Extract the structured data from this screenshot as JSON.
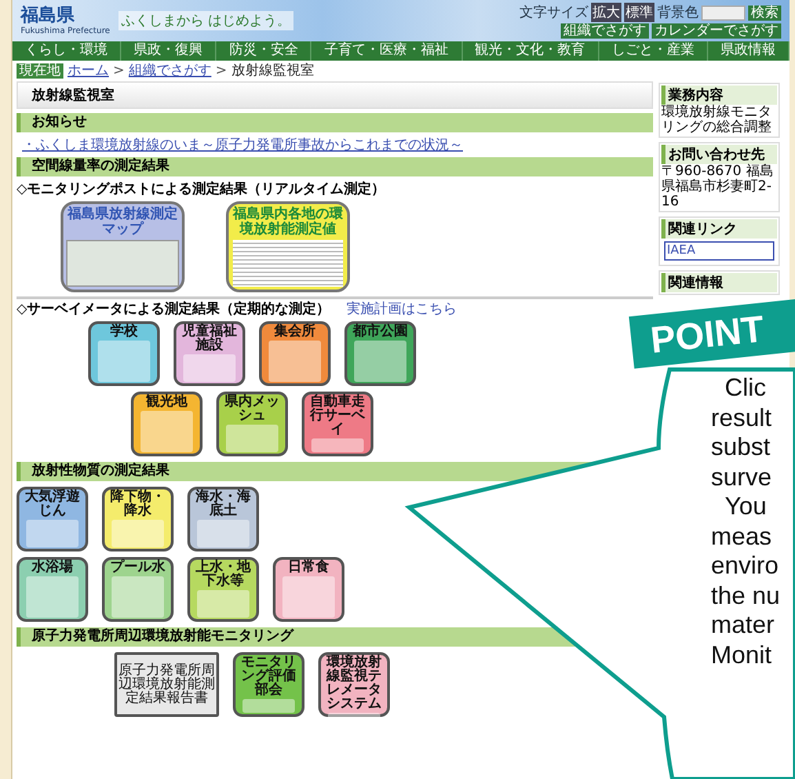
{
  "header": {
    "logo": "福島県",
    "logo_sub": "Fukushima Prefecture",
    "tagline": "ふくしまから はじめよう。",
    "controls": [
      "文字サイズ",
      "拡大",
      "標準",
      "背景色"
    ],
    "search_button": "検索",
    "buttons": [
      "組織でさがす",
      "カレンダーでさがす"
    ]
  },
  "nav": [
    "くらし・環境",
    "県政・復興",
    "防災・安全",
    "子育て・医療・福祉",
    "観光・文化・教育",
    "しごと・産業",
    "県政情報"
  ],
  "breadcrumb": {
    "label": "現在地",
    "separator": ">",
    "items": [
      "ホーム",
      "組織でさがす",
      "放射線監視室"
    ]
  },
  "page_title": "放射線監視室",
  "sections": [
    {
      "title": "お知らせ",
      "links": [
        "・ふくしま環境放射線のいま～原子力発電所事故からこれまでの状況～"
      ]
    },
    {
      "title": "空間線量率の測定結果",
      "groups": [
        {
          "caption": "◇モニタリングポストによる測定結果（リアルタイム測定）",
          "cards": [
            {
              "kind": "map",
              "label": "福島県放射線測定マップ",
              "color": "#b7bfe6"
            },
            {
              "kind": "table",
              "label": "福島県内各地の環境放射能測定値",
              "color": "#f2ec4a"
            }
          ]
        },
        {
          "caption": "◇サーベイメータによる測定結果（定期的な測定）",
          "link": "実施計画はこちら",
          "rows": [
            [
              {
                "label": "学校",
                "color": "#6ec7dc"
              },
              {
                "label": "児童福祉施設",
                "color": "#e3b6dc"
              },
              {
                "label": "集会所",
                "color": "#f08a3c"
              },
              {
                "label": "都市公園",
                "color": "#3fa65a"
              }
            ],
            [
              {
                "label": "観光地",
                "color": "#f4b531"
              },
              {
                "label": "県内メッシュ",
                "color": "#a8d04a"
              },
              {
                "label": "自動車走行サーベイ",
                "color": "#ee7a86"
              }
            ]
          ]
        }
      ]
    },
    {
      "title": "放射性物質の測定結果",
      "groups": [
        {
          "rows": [
            [
              {
                "label": "大気浮遊じん",
                "color": "#8fb7e2"
              },
              {
                "label": "降下物・降水",
                "color": "#f4ec6c"
              },
              {
                "label": "海水・海底土",
                "color": "#b9c6d9"
              }
            ],
            [
              {
                "label": "水浴場",
                "color": "#8ccfb0"
              },
              {
                "label": "プール水",
                "color": "#9ed48e"
              },
              {
                "label": "上水・地下水等",
                "color": "#b6d960"
              },
              {
                "label": "日常食",
                "color": "#f2b3c0"
              }
            ]
          ]
        }
      ]
    },
    {
      "title": "原子力発電所周辺環境放射能モニタリング",
      "groups": [
        {
          "rows": [
            [
              {
                "kind": "document",
                "label": "原子力発電所周辺環境放射能測定結果報告書",
                "color": "#e8e8e8"
              },
              {
                "kind": "picture",
                "label": "モニタリング評価部会",
                "color": "#74c24a"
              },
              {
                "kind": "picture",
                "label": "環境放射線監視テレメータシステム",
                "color": "#f2b3c0"
              }
            ]
          ]
        }
      ]
    }
  ],
  "sidebar": [
    {
      "title": "業務内容",
      "text": "環境放射線モニタリングの総合調整"
    },
    {
      "title": "お問い合わせ先",
      "text": "〒960-8670 福島県福島市杉妻町2-16"
    },
    {
      "title": "関連リンク",
      "banner": "IAEA"
    },
    {
      "title": "関連情報"
    }
  ],
  "callout": {
    "tag": "POINT",
    "lines": [
      "Clic",
      "result",
      "subst",
      "surve",
      "You",
      "meas",
      "enviro",
      "the nu",
      "mater",
      "Monit"
    ]
  }
}
